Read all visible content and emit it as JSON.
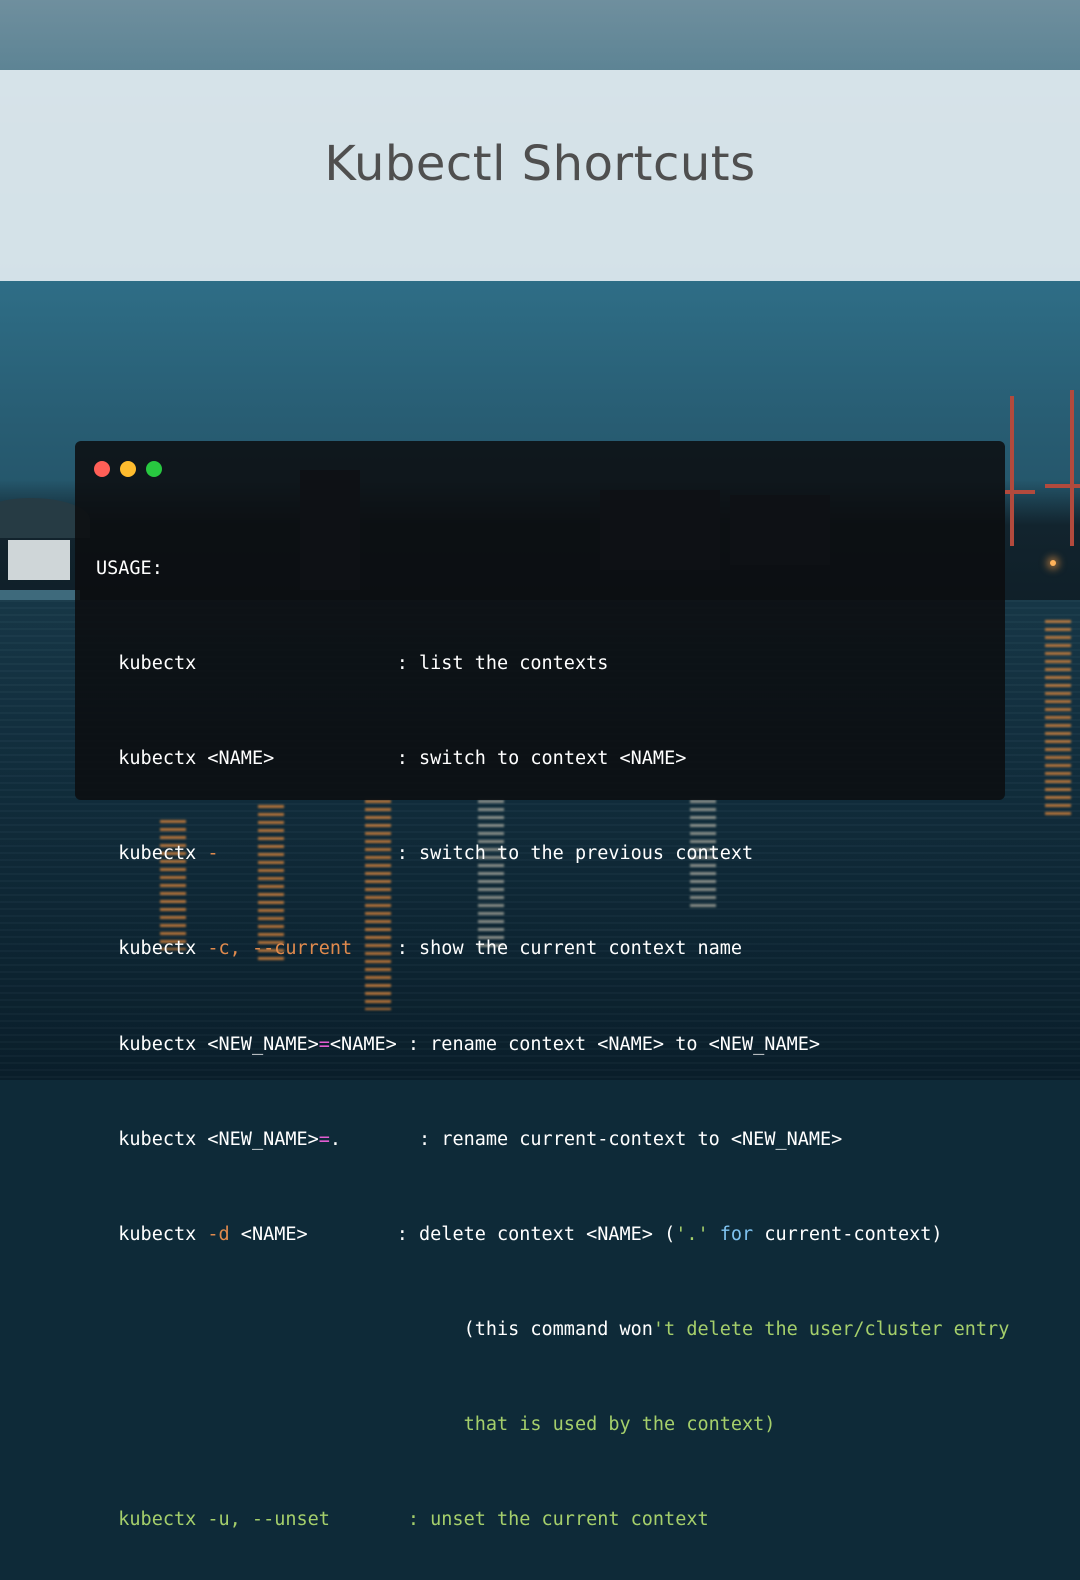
{
  "title": "Kubectl Shortcuts",
  "terminal": {
    "window_buttons": [
      "close",
      "minimize",
      "maximize"
    ],
    "usage_label": "USAGE:",
    "lines": [
      {
        "cmd": "kubectx",
        "flag": "",
        "arg": "",
        "pad": "                  ",
        "sep": ": ",
        "desc": "list the contexts"
      },
      {
        "cmd": "kubectx ",
        "flag": "",
        "arg": "<NAME>",
        "pad": "           ",
        "sep": ": ",
        "desc": "switch to context <NAME>"
      },
      {
        "cmd": "kubectx ",
        "flag": "-",
        "arg": "",
        "pad": "                ",
        "sep": ": ",
        "desc": "switch to the previous context"
      },
      {
        "cmd": "kubectx ",
        "flag": "-c, --current",
        "arg": "",
        "pad": "    ",
        "sep": ": ",
        "desc": "show the current context name"
      },
      {
        "cmd": "kubectx ",
        "arg1": "<NEW_NAME>",
        "eq": "=",
        "arg2": "<NAME>",
        "sep": " : ",
        "desc": "rename context <NAME> to <NEW_NAME>"
      },
      {
        "cmd": "kubectx ",
        "arg1": "<NEW_NAME>",
        "eq": "=",
        "dot": ".",
        "pad": "       ",
        "sep": ": ",
        "desc": "rename current-context to <NEW_NAME>"
      },
      {
        "cmd": "kubectx ",
        "flag": "-d",
        "arg": " <NAME>",
        "pad": "        ",
        "sep": ": ",
        "desc_a": "delete context <NAME> (",
        "desc_str": "'.'",
        "desc_kw": " for",
        "desc_b": " current-context)"
      },
      {
        "indent": "                                 ",
        "desc_a": "(this command won",
        "desc_comment": "'t delete the user/cluster entry"
      },
      {
        "indent": "                                 ",
        "desc_comment": "that is used by the context)"
      },
      {
        "cmd": "kubectx -u, --unset",
        "pad": "       ",
        "sep": ": ",
        "desc": "unset the current context"
      }
    ]
  },
  "colors": {
    "banner_bg": "#dee9ee",
    "title_text": "#4f4f4f",
    "terminal_bg": "#0c0d0f",
    "flag": "#e08a4d",
    "operator": "#e35dd2",
    "keyword": "#7fc3f0",
    "comment": "#a5cf6b"
  }
}
